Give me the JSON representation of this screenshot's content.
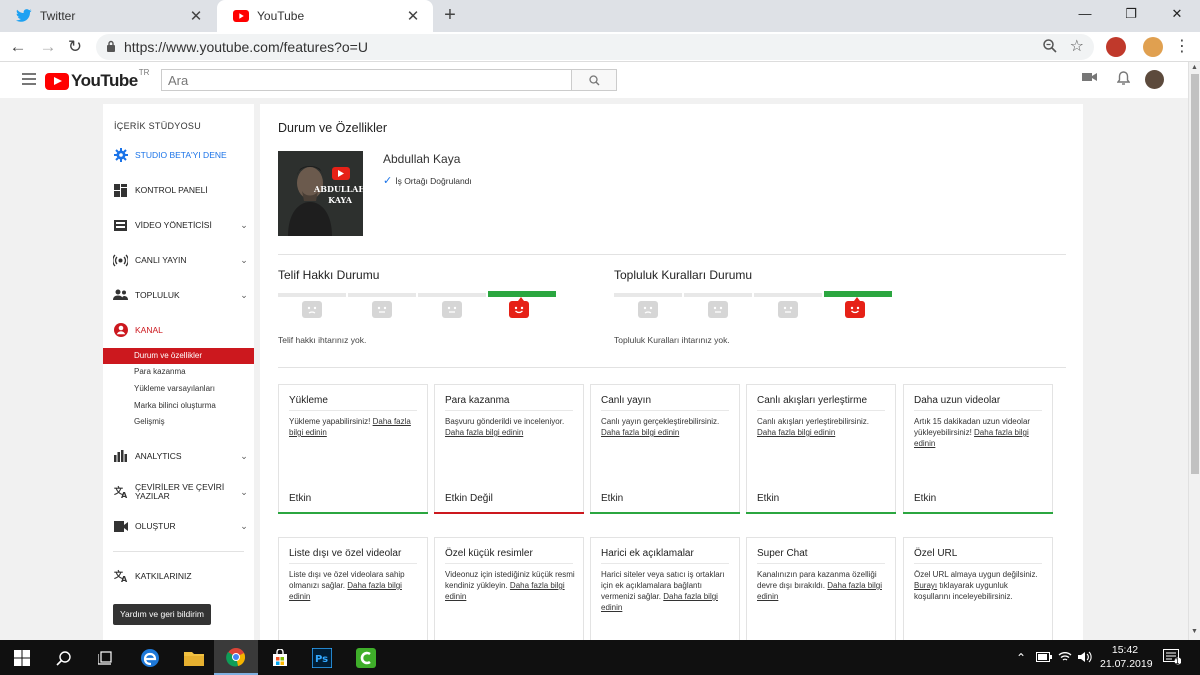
{
  "browser": {
    "tabs": [
      {
        "label": "Twitter",
        "icon": "twitter-icon"
      },
      {
        "label": "YouTube",
        "icon": "youtube-icon"
      }
    ],
    "url": "https://www.youtube.com/features?o=U"
  },
  "header": {
    "logo_text": "YouTube",
    "logo_region": "TR",
    "search_placeholder": "Ara"
  },
  "sidebar": {
    "title": "İÇERİK STÜDYOSU",
    "items": [
      {
        "label": "STUDIO BETA'YI DENE",
        "icon": "gear-icon"
      },
      {
        "label": "KONTROL PANELİ",
        "icon": "dashboard-icon"
      },
      {
        "label": "VİDEO YÖNETİCİSİ",
        "icon": "video-manager-icon"
      },
      {
        "label": "CANLI YAYIN",
        "icon": "live-icon"
      },
      {
        "label": "TOPLULUK",
        "icon": "community-icon"
      },
      {
        "label": "KANAL",
        "icon": "channel-icon"
      },
      {
        "label": "ANALYTICS",
        "icon": "analytics-icon"
      },
      {
        "label": "ÇEVİRİLER VE ÇEVİRİ YAZILAR",
        "icon": "translate-icon"
      },
      {
        "label": "OLUŞTUR",
        "icon": "create-icon"
      },
      {
        "label": "KATKILARINIZ",
        "icon": "contributions-icon"
      }
    ],
    "channel_subitems": [
      "Durum ve özellikler",
      "Para kazanma",
      "Yükleme varsayılanları",
      "Marka bilinci oluşturma",
      "Gelişmiş"
    ],
    "help_button": "Yardım ve geri bildirim"
  },
  "main": {
    "title": "Durum ve Özellikler",
    "channel_name": "Abdullah Kaya",
    "thumbnail_text_1": "ABDULLAH",
    "thumbnail_text_2": "KAYA",
    "verified_text": "İş Ortağı Doğrulandı",
    "copyright": {
      "title": "Telif Hakkı Durumu",
      "text": "Telif hakkı ihtarınız yok."
    },
    "community": {
      "title": "Topluluk Kuralları Durumu",
      "text": "Topluluk Kuralları ihtarınız yok."
    },
    "features": [
      {
        "title": "Yükleme",
        "desc": "Yükleme yapabilirsiniz! ",
        "link": "Daha fazla bilgi edinin",
        "status": "Etkin",
        "bar": "green"
      },
      {
        "title": "Para kazanma",
        "desc": "Başvuru gönderildi ve inceleniyor. ",
        "link": "Daha fazla bilgi edinin",
        "status": "Etkin Değil",
        "bar": "red"
      },
      {
        "title": "Canlı yayın",
        "desc": "Canlı yayın gerçekleştirebilirsiniz. ",
        "link": "Daha fazla bilgi edinin",
        "status": "Etkin",
        "bar": "green"
      },
      {
        "title": "Canlı akışları yerleştirme",
        "desc": "Canlı akışları yerleştirebilirsiniz. ",
        "link": "Daha fazla bilgi edinin",
        "status": "Etkin",
        "bar": "green"
      },
      {
        "title": "Daha uzun videolar",
        "desc": "Artık 15 dakikadan uzun videolar yükleyebilirsiniz! ",
        "link": "Daha fazla bilgi edinin",
        "status": "Etkin",
        "bar": "green"
      },
      {
        "title": "Liste dışı ve özel videolar",
        "desc": "Liste dışı ve özel videolara sahip olmanızı sağlar. ",
        "link": "Daha fazla bilgi edinin"
      },
      {
        "title": "Özel küçük resimler",
        "desc": "Videonuz için istediğiniz küçük resmi kendiniz yükleyin. ",
        "link": "Daha fazla bilgi edinin"
      },
      {
        "title": "Harici ek açıklamalar",
        "desc": "Harici siteler veya satıcı iş ortakları için ek açıklamalara bağlantı vermenizi sağlar. ",
        "link": "Daha fazla bilgi edinin"
      },
      {
        "title": "Super Chat",
        "desc": "Kanalınızın para kazanma özelliği devre dışı bırakıldı. ",
        "link": "Daha fazla bilgi edinin"
      },
      {
        "title": "Özel URL",
        "desc": "Özel URL almaya uygun değilsiniz. ",
        "link": "Burayı",
        "desc2": " tıklayarak uygunluk koşullarını inceleyebilirsiniz."
      }
    ]
  },
  "taskbar": {
    "time": "15:42",
    "date": "21.07.2019",
    "notification_count": "1"
  },
  "colors": {
    "youtube_red": "#ff0000",
    "active_red": "#cc181e",
    "enabled_green": "#2ba640",
    "studio_blue": "#1a73e8"
  }
}
